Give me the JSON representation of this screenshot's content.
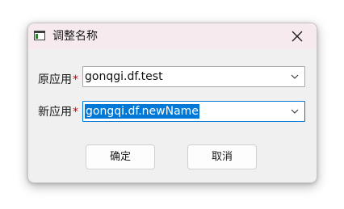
{
  "window": {
    "title": "调整名称",
    "app_icon": "window-app-icon",
    "close_icon": "close-icon"
  },
  "form": {
    "original_label": "原应用",
    "new_label": "新应用",
    "required_mark": "*",
    "original_value": "gonqgi.df.test",
    "new_value": "gongqi.df.newName",
    "dropdown_icon": "chevron-down-icon"
  },
  "buttons": {
    "confirm": "确定",
    "cancel": "取消"
  },
  "colors": {
    "titlebar_bg": "#f6eaef",
    "selection_bg": "#0078d7",
    "required": "#d0021b",
    "focus_border": "#0078d4"
  }
}
